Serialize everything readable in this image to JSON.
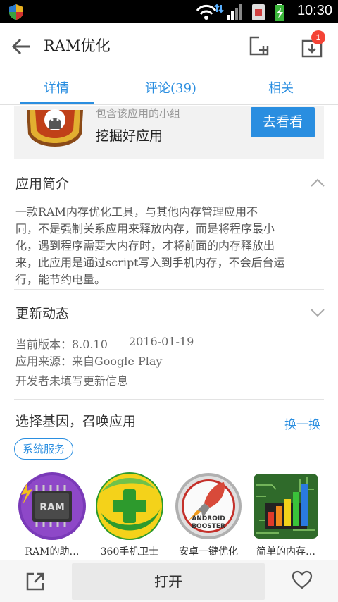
{
  "status_bar": {
    "time": "10:30"
  },
  "toolbar": {
    "title": "RAM优化",
    "download_badge": "1"
  },
  "tabs": [
    {
      "label": "详情",
      "active": true
    },
    {
      "label": "评论(39)",
      "active": false
    },
    {
      "label": "相关",
      "active": false
    }
  ],
  "group_card": {
    "subtitle": "包含该应用的小组",
    "name": "挖掘好应用",
    "button": "去看看"
  },
  "intro": {
    "title": "应用简介",
    "lines": [
      "一款RAM内存优化工具，与其他内存管理应用不",
      "同，不是强制关系应用来释放内存，而是将程序最小",
      "化，遇到程序需要大内存时，才将前面的内存释放出",
      "来，此应用是通过script写入到手机内存，不会后台运",
      "行，能节约电量。"
    ]
  },
  "updates": {
    "title": "更新动态",
    "version_line": "当前版本：8.0.10",
    "date": "2016-01-19",
    "source_line": "应用来源：来自Google Play",
    "note": "开发者未填写更新信息"
  },
  "recommend": {
    "title": "选择基因，召唤应用",
    "switch_label": "换一换",
    "tag": "系统服务",
    "apps": [
      {
        "label": "RAM的助…",
        "icon": "ram-chip-icon"
      },
      {
        "label": "360手机卫士",
        "icon": "360-security-icon"
      },
      {
        "label": "安卓一键优化",
        "icon": "android-booster-icon"
      },
      {
        "label": "简单的内存…",
        "icon": "memory-chart-icon"
      }
    ]
  },
  "bottom_bar": {
    "open_label": "打开"
  },
  "colors": {
    "accent": "#2a8ee0",
    "badge": "#f44336"
  }
}
